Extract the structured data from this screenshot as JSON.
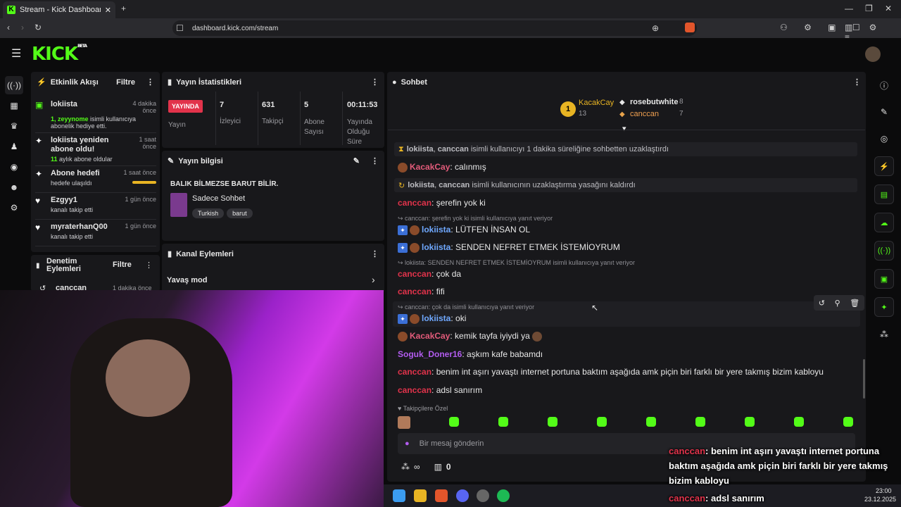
{
  "browser": {
    "tab_title": "Stream - Kick Dashboard",
    "url": "dashboard.kick.com/stream"
  },
  "app": {
    "logo": "KICK",
    "logo_sup": "BETA"
  },
  "activity": {
    "title": "Etkinlik Akışı",
    "filter": "Filtre",
    "items": [
      {
        "name": "lokiista",
        "time": "4 dakika önce",
        "line1_highlight": "1, zeyynome",
        "line1": " isimli kullanıcıya",
        "line2": "abonelik hediye etti.",
        "icon": "gift-icon"
      },
      {
        "name": "lokiista yeniden abone oldu!",
        "time": "1 saat önce",
        "line1_highlight": "11",
        "line1": " aylık abone oldular",
        "line2": "",
        "icon": "sparkle-icon"
      },
      {
        "name": "Abone hedefi",
        "time": "1 saat önce",
        "line1_highlight": "",
        "line1": "hedefe ulaşıldı",
        "line2": "",
        "icon": "sparkle-icon"
      },
      {
        "name": "Ezgyy1",
        "time": "1 gün önce",
        "line1_highlight": "",
        "line1": "kanalı takip etti",
        "line2": "",
        "icon": "heart-icon"
      },
      {
        "name": "myraterhanQ00",
        "time": "1 gün önce",
        "line1_highlight": "",
        "line1": "kanalı takip etti",
        "line2": "",
        "icon": "heart-icon"
      }
    ]
  },
  "moderation": {
    "title": "Denetim Eylemleri",
    "filter": "Filtre",
    "item_name": "canccan",
    "item_time": "1 dakika önce"
  },
  "stats": {
    "title": "Yayın İstatistikleri",
    "live_badge": "YAYINDA",
    "live_label": "Yayın",
    "viewers": "7",
    "viewers_label": "İzleyici",
    "followers": "631",
    "followers_label": "Takipçi",
    "subs": "5",
    "subs_label": "Abone Sayısı",
    "duration": "00:11:53",
    "duration_label": "Yayında Olduğu Süre"
  },
  "stream_info": {
    "title": "Yayın bilgisi",
    "stream_title": "BALIK BİLMEZSE BARUT BİLİR.",
    "category": "Sadece Sohbet",
    "tags": [
      "Turkish",
      "barut"
    ]
  },
  "channel_actions": {
    "title": "Kanal Eylemleri",
    "slow_mode": "Yavaş mod"
  },
  "chat": {
    "title": "Sohbet",
    "leaders": [
      {
        "rank": "1",
        "name": "KacakCay",
        "count": "13"
      },
      {
        "name": "rosebutwhite",
        "count": "8"
      },
      {
        "name": "canccan",
        "count": "7"
      }
    ],
    "system1_a": "lokiista",
    "system1_b": "canccan",
    "system1_text": "isimli kullanıcıyı 1 dakika süreliğine sohbetten uzaklaştırdı",
    "m1_user": "KacakCay",
    "m1_text": "calınmış",
    "system2_a": "lokiista",
    "system2_b": "canccan",
    "system2_text": "isimli kullanıcının uzaklaştırma yasağını kaldırdı",
    "m2_user": "canccan",
    "m2_text": "şerefin yok ki",
    "reply1": "canccan: şerefin yok ki isimli kullanıcıya yanıt veriyor",
    "m3_user": "lokiista",
    "m3_text": "LÜTFEN İNSAN OL",
    "m4_user": "lokiista",
    "m4_text": "SENDEN NEFRET ETMEK İSTEMİOYRUM",
    "reply2": "lokiista: SENDEN NEFRET ETMEK İSTEMİOYRUM isimli kullanıcıya yanıt veriyor",
    "m5_user": "canccan",
    "m5_text": "çok da",
    "m6_user": "canccan",
    "m6_text": "fifi",
    "reply3": "canccan: çok da isimli kullanıcıya yanıt veriyor",
    "m7_user": "lokiista",
    "m7_text": "oki",
    "m8_user": "KacakCay",
    "m8_text": "kemik tayfa iyiydi ya",
    "m9_user": "Soguk_Doner16",
    "m9_text": "aşkım kafe babamdı",
    "m10_user": "canccan",
    "m10_text": "benim int aşırı yavaştı internet portuna baktım aşağıda amk piçin biri farklı bir yere takmış bizim kabloyu",
    "m11_user": "canccan",
    "m11_text": "adsl sanırım",
    "followers_only": "Takipçilere Özel",
    "input_placeholder": "Bir mesaj gönderin",
    "infinity": "∞",
    "points": "0"
  },
  "overlay": {
    "line1_user": "canccan",
    "line1_text": ": benim int aşırı yavaştı internet portuna",
    "line2": "baktım aşağıda amk piçin biri farklı bir yere takmış",
    "line3": "bizim kabloyu",
    "line4_user": "canccan",
    "line4_text": ": adsl sanırım"
  },
  "taskbar": {
    "time": "23:00",
    "date": "23.12.2025"
  },
  "colors": {
    "accent": "#53fc18",
    "live": "#e2334b"
  }
}
